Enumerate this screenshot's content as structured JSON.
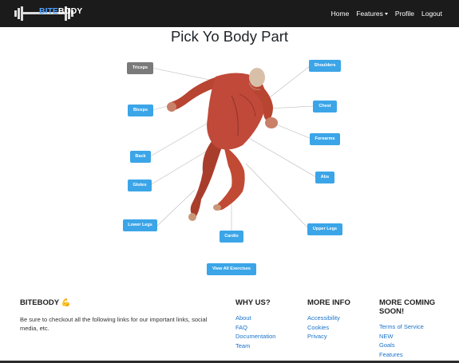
{
  "navbar": {
    "logo": {
      "part1": "BITE",
      "part2": "BODY"
    },
    "links": [
      {
        "label": "Home"
      },
      {
        "label": "Features",
        "dropdown": true
      },
      {
        "label": "Profile"
      },
      {
        "label": "Logout"
      }
    ]
  },
  "page": {
    "title": "Pick Yo Body Part"
  },
  "body_parts": {
    "triceps": "Triceps",
    "biceps": "Biceps",
    "back": "Back",
    "glutes": "Glutes",
    "lower_legs": "Lower Legs",
    "cardio": "Cardio",
    "shoulders": "Shoulders",
    "chest": "Chest",
    "forearms": "Forearms",
    "abs": "Abs",
    "upper_legs": "Upper Legs",
    "selected": "triceps"
  },
  "all_button": "View All Exercises",
  "footer": {
    "brand": {
      "title": "BITEBODY",
      "emoji": "💪",
      "text": "Be sure to checkout all the following links for our important links, social media, etc."
    },
    "why_us": {
      "title": "WHY US?",
      "links": [
        "About",
        "FAQ",
        "Documentation",
        "Team"
      ]
    },
    "more_info": {
      "title": "MORE INFO",
      "links": [
        "Accessibility",
        "Cookies",
        "Privacy"
      ]
    },
    "coming_soon": {
      "title": "MORE COMING SOON!",
      "links": [
        "Terms of Service",
        "NEW",
        "Goals",
        "Features"
      ]
    }
  },
  "colors": {
    "navbar_bg": "#1b1b1b",
    "button_blue": "#3ba5e8",
    "button_selected": "#7a7a7a",
    "link_blue": "#1a73c9"
  }
}
